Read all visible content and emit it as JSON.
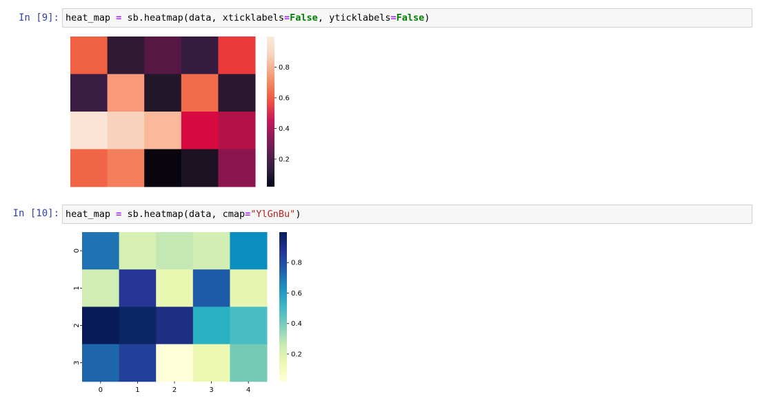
{
  "cells": [
    {
      "prompt": "In [9]:",
      "code": {
        "var": "heat_map",
        "eq": "=",
        "call": "sb.heatmap(",
        "args1": "data, xticklabels",
        "eq2": "=",
        "kw1": "False",
        "args2": ", yticklabels",
        "eq3": "=",
        "kw2": "False",
        "close": ")"
      }
    },
    {
      "prompt": "In [10]:",
      "code": {
        "var": "heat_map",
        "eq": "=",
        "call": "sb.heatmap(",
        "args1": "data, cmap",
        "eq2": "=",
        "str": "\"YlGnBu\"",
        "close": ")"
      }
    }
  ],
  "chart_data": [
    {
      "type": "heatmap",
      "cmap": "rocket",
      "rows": 4,
      "cols": 5,
      "values": [
        [
          0.71,
          0.17,
          0.26,
          0.19,
          0.66
        ],
        [
          0.21,
          0.84,
          0.13,
          0.74,
          0.15
        ],
        [
          0.99,
          0.94,
          0.88,
          0.51,
          0.43
        ],
        [
          0.73,
          0.78,
          0.03,
          0.1,
          0.36
        ]
      ],
      "xticklabels": [],
      "yticklabels": [],
      "colorbar_ticks": [
        "0.2",
        "0.4",
        "0.6",
        "0.8"
      ],
      "colorbar_tick_values": [
        0.2,
        0.4,
        0.6,
        0.8
      ],
      "vmin": 0.02,
      "vmax": 1.0,
      "colors": [
        [
          "#f06043",
          "#2f1934",
          "#581845",
          "#351b40",
          "#ec3a3a"
        ],
        [
          "#3b1c43",
          "#f9997a",
          "#201729",
          "#f26c4c",
          "#291830"
        ],
        [
          "#fbe3d5",
          "#f7d3bd",
          "#f9b99a",
          "#d70a41",
          "#b21247"
        ],
        [
          "#f06545",
          "#f37e5c",
          "#08050f",
          "#1c1222",
          "#8c144f"
        ]
      ]
    },
    {
      "type": "heatmap",
      "cmap": "YlGnBu",
      "rows": 4,
      "cols": 5,
      "values": [
        [
          0.64,
          0.22,
          0.29,
          0.25,
          0.62
        ],
        [
          0.26,
          0.87,
          0.15,
          0.72,
          0.16
        ],
        [
          1.0,
          0.96,
          0.9,
          0.52,
          0.42
        ],
        [
          0.73,
          0.82,
          0.03,
          0.14,
          0.36
        ]
      ],
      "xticklabels": [
        "0",
        "1",
        "2",
        "3",
        "4"
      ],
      "yticklabels": [
        "0",
        "1",
        "2",
        "3"
      ],
      "colorbar_ticks": [
        "0.2",
        "0.4",
        "0.6",
        "0.8"
      ],
      "colorbar_tick_values": [
        0.2,
        0.4,
        0.6,
        0.8
      ],
      "vmin": 0.02,
      "vmax": 1.0,
      "colors": [
        [
          "#1f73b2",
          "#d6efb3",
          "#c4e8b4",
          "#d3eeb3",
          "#0a8dbf"
        ],
        [
          "#d0edb3",
          "#253495",
          "#eaf7b1",
          "#1d5ba6",
          "#e6f5b1"
        ],
        [
          "#081d58",
          "#0b2764",
          "#1d2e83",
          "#2ab2c3",
          "#48bdc3"
        ],
        [
          "#1f65ac",
          "#22409a",
          "#ffffd9",
          "#edf8b2",
          "#74cab4"
        ]
      ]
    }
  ]
}
